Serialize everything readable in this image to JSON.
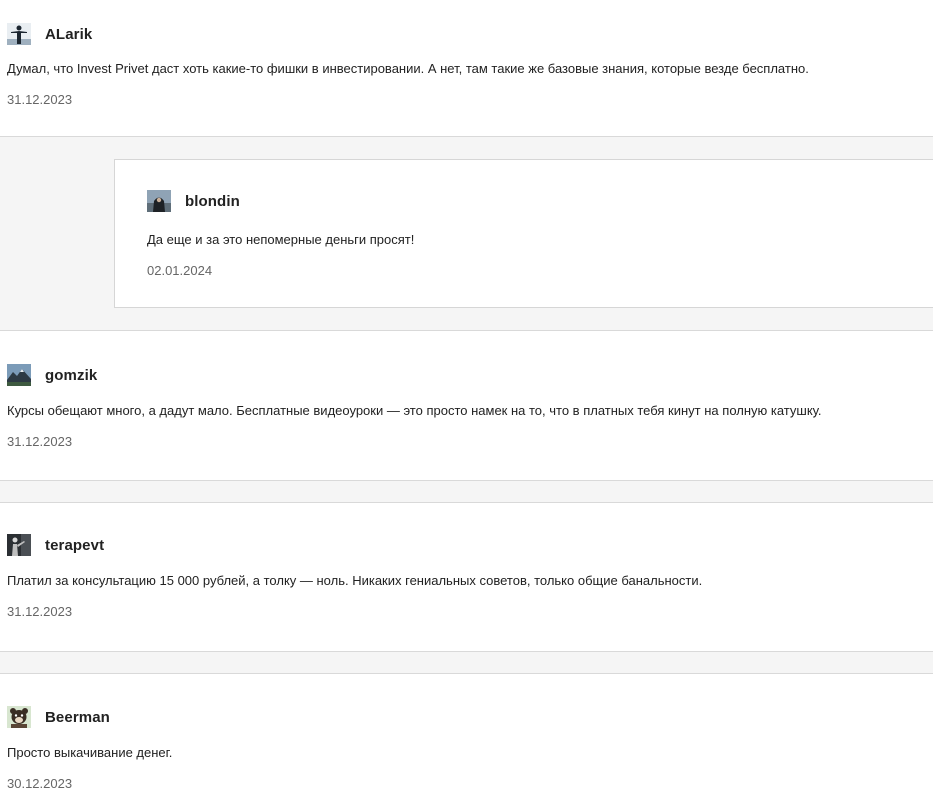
{
  "comments": [
    {
      "author": "ALarik",
      "avatar_icon": "standing-figure-avatar-icon",
      "text": "Думал, что Invest Privet даст хоть какие-то фишки в инвестировании. А нет, там такие же базовые знания, которые везде бесплатно.",
      "date": "31.12.2023"
    },
    {
      "author": "gomzik",
      "avatar_icon": "mountain-landscape-avatar-icon",
      "text": "Курсы обещают много, а дадут мало. Бесплатные видеоуроки — это просто намек на то, что в платных тебя кинут на полную катушку.",
      "date": "31.12.2023"
    },
    {
      "author": "terapevt",
      "avatar_icon": "dark-figure-avatar-icon",
      "text": "Платил за консультацию 15 000 рублей, а толку — ноль. Никаких гениальных советов, только общие банальности.",
      "date": "31.12.2023"
    },
    {
      "author": "Beerman",
      "avatar_icon": "cartoon-bear-avatar-icon",
      "text": "Просто выкачивание денег.",
      "date": "30.12.2023"
    }
  ],
  "reply": {
    "author": "blondin",
    "avatar_icon": "hooded-figure-avatar-icon",
    "text": "Да еще и за это непомерные деньги просят!",
    "date": "02.01.2024"
  },
  "colors": {
    "text": "#222222",
    "date": "#666666",
    "band": "#f5f5f5",
    "border": "#d9d9d9"
  }
}
